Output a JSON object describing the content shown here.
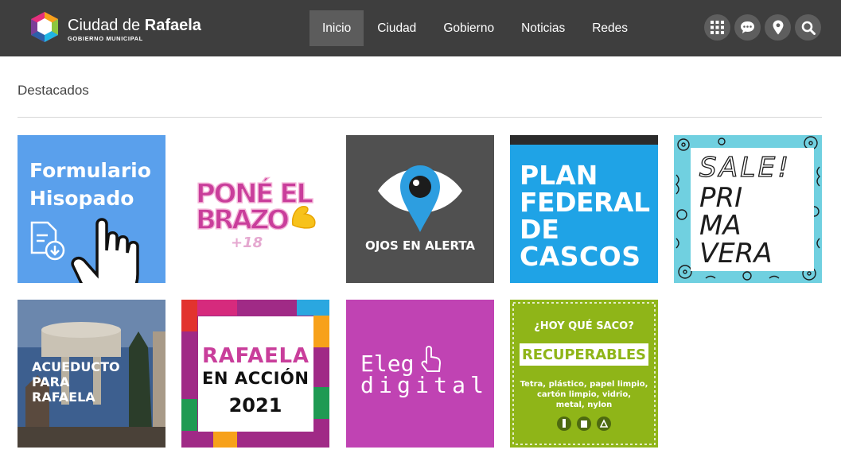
{
  "header": {
    "brand_title_light": "Ciudad de ",
    "brand_title_bold": "Rafaela",
    "brand_subtitle": "GOBIERNO MUNICIPAL",
    "nav": [
      {
        "label": "Inicio",
        "active": true
      },
      {
        "label": "Ciudad",
        "active": false
      },
      {
        "label": "Gobierno",
        "active": false
      },
      {
        "label": "Noticias",
        "active": false
      },
      {
        "label": "Redes",
        "active": false
      }
    ],
    "icons": [
      "grid-icon",
      "chat-icon",
      "location-pin-icon",
      "search-icon"
    ]
  },
  "main": {
    "section_title": "Destacados",
    "tiles": [
      {
        "name": "formulario-hisopado",
        "lines": [
          "Formulario",
          "Hisopado"
        ],
        "bg": "#5aa0ec"
      },
      {
        "name": "pone-el-brazo",
        "lines": [
          "PONÉ EL",
          "BRAZO",
          "+18"
        ],
        "bg": "#ffffff"
      },
      {
        "name": "ojos-en-alerta",
        "lines": [
          "OJOS EN ALERTA"
        ],
        "bg": "#505050"
      },
      {
        "name": "plan-federal-de-cascos",
        "lines": [
          "PLAN",
          "FEDERAL",
          "DE",
          "CASCOS"
        ],
        "bg": "#1fa3e6"
      },
      {
        "name": "sale-primavera",
        "lines": [
          "SALE!",
          "PRI",
          "MA",
          "VERA"
        ],
        "bg": "#70d0e0"
      },
      {
        "name": "acueducto-para-rafaela",
        "lines": [
          "ACUEDUCTO",
          "PARA",
          "RAFAELA"
        ],
        "bg": "#3d5f8f"
      },
      {
        "name": "rafaela-en-accion-2021",
        "lines": [
          "RAFAELA",
          "EN ACCIÓN",
          "2021"
        ],
        "bg": "#a02a86"
      },
      {
        "name": "elegi-digital",
        "lines": [
          "Eleg",
          "digital"
        ],
        "bg": "#c043b3"
      },
      {
        "name": "recuperables",
        "lines": [
          "¿HOY QUÉ SACO?",
          "RECUPERABLES",
          "Tetra, plástico, papel limpio,",
          "cartón limpio, vidrio,",
          "metal, nylon"
        ],
        "bg": "#8fb518"
      }
    ]
  }
}
